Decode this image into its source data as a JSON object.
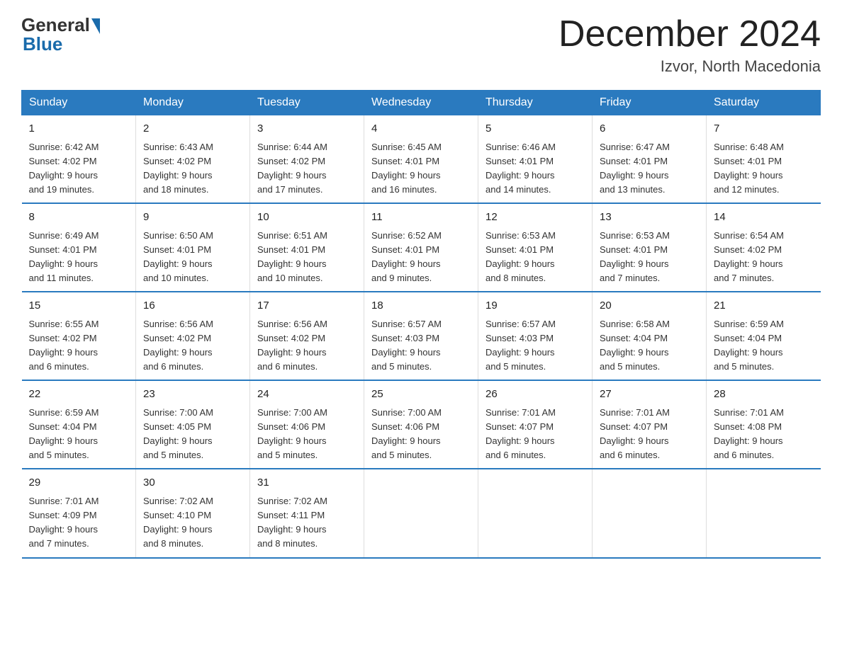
{
  "header": {
    "logo_general": "General",
    "logo_blue": "Blue",
    "month_title": "December 2024",
    "location": "Izvor, North Macedonia"
  },
  "weekdays": [
    "Sunday",
    "Monday",
    "Tuesday",
    "Wednesday",
    "Thursday",
    "Friday",
    "Saturday"
  ],
  "weeks": [
    [
      {
        "day": "1",
        "sunrise": "6:42 AM",
        "sunset": "4:02 PM",
        "daylight": "9 hours and 19 minutes."
      },
      {
        "day": "2",
        "sunrise": "6:43 AM",
        "sunset": "4:02 PM",
        "daylight": "9 hours and 18 minutes."
      },
      {
        "day": "3",
        "sunrise": "6:44 AM",
        "sunset": "4:02 PM",
        "daylight": "9 hours and 17 minutes."
      },
      {
        "day": "4",
        "sunrise": "6:45 AM",
        "sunset": "4:01 PM",
        "daylight": "9 hours and 16 minutes."
      },
      {
        "day": "5",
        "sunrise": "6:46 AM",
        "sunset": "4:01 PM",
        "daylight": "9 hours and 14 minutes."
      },
      {
        "day": "6",
        "sunrise": "6:47 AM",
        "sunset": "4:01 PM",
        "daylight": "9 hours and 13 minutes."
      },
      {
        "day": "7",
        "sunrise": "6:48 AM",
        "sunset": "4:01 PM",
        "daylight": "9 hours and 12 minutes."
      }
    ],
    [
      {
        "day": "8",
        "sunrise": "6:49 AM",
        "sunset": "4:01 PM",
        "daylight": "9 hours and 11 minutes."
      },
      {
        "day": "9",
        "sunrise": "6:50 AM",
        "sunset": "4:01 PM",
        "daylight": "9 hours and 10 minutes."
      },
      {
        "day": "10",
        "sunrise": "6:51 AM",
        "sunset": "4:01 PM",
        "daylight": "9 hours and 10 minutes."
      },
      {
        "day": "11",
        "sunrise": "6:52 AM",
        "sunset": "4:01 PM",
        "daylight": "9 hours and 9 minutes."
      },
      {
        "day": "12",
        "sunrise": "6:53 AM",
        "sunset": "4:01 PM",
        "daylight": "9 hours and 8 minutes."
      },
      {
        "day": "13",
        "sunrise": "6:53 AM",
        "sunset": "4:01 PM",
        "daylight": "9 hours and 7 minutes."
      },
      {
        "day": "14",
        "sunrise": "6:54 AM",
        "sunset": "4:02 PM",
        "daylight": "9 hours and 7 minutes."
      }
    ],
    [
      {
        "day": "15",
        "sunrise": "6:55 AM",
        "sunset": "4:02 PM",
        "daylight": "9 hours and 6 minutes."
      },
      {
        "day": "16",
        "sunrise": "6:56 AM",
        "sunset": "4:02 PM",
        "daylight": "9 hours and 6 minutes."
      },
      {
        "day": "17",
        "sunrise": "6:56 AM",
        "sunset": "4:02 PM",
        "daylight": "9 hours and 6 minutes."
      },
      {
        "day": "18",
        "sunrise": "6:57 AM",
        "sunset": "4:03 PM",
        "daylight": "9 hours and 5 minutes."
      },
      {
        "day": "19",
        "sunrise": "6:57 AM",
        "sunset": "4:03 PM",
        "daylight": "9 hours and 5 minutes."
      },
      {
        "day": "20",
        "sunrise": "6:58 AM",
        "sunset": "4:04 PM",
        "daylight": "9 hours and 5 minutes."
      },
      {
        "day": "21",
        "sunrise": "6:59 AM",
        "sunset": "4:04 PM",
        "daylight": "9 hours and 5 minutes."
      }
    ],
    [
      {
        "day": "22",
        "sunrise": "6:59 AM",
        "sunset": "4:04 PM",
        "daylight": "9 hours and 5 minutes."
      },
      {
        "day": "23",
        "sunrise": "7:00 AM",
        "sunset": "4:05 PM",
        "daylight": "9 hours and 5 minutes."
      },
      {
        "day": "24",
        "sunrise": "7:00 AM",
        "sunset": "4:06 PM",
        "daylight": "9 hours and 5 minutes."
      },
      {
        "day": "25",
        "sunrise": "7:00 AM",
        "sunset": "4:06 PM",
        "daylight": "9 hours and 5 minutes."
      },
      {
        "day": "26",
        "sunrise": "7:01 AM",
        "sunset": "4:07 PM",
        "daylight": "9 hours and 6 minutes."
      },
      {
        "day": "27",
        "sunrise": "7:01 AM",
        "sunset": "4:07 PM",
        "daylight": "9 hours and 6 minutes."
      },
      {
        "day": "28",
        "sunrise": "7:01 AM",
        "sunset": "4:08 PM",
        "daylight": "9 hours and 6 minutes."
      }
    ],
    [
      {
        "day": "29",
        "sunrise": "7:01 AM",
        "sunset": "4:09 PM",
        "daylight": "9 hours and 7 minutes."
      },
      {
        "day": "30",
        "sunrise": "7:02 AM",
        "sunset": "4:10 PM",
        "daylight": "9 hours and 8 minutes."
      },
      {
        "day": "31",
        "sunrise": "7:02 AM",
        "sunset": "4:11 PM",
        "daylight": "9 hours and 8 minutes."
      },
      null,
      null,
      null,
      null
    ]
  ],
  "labels": {
    "sunrise": "Sunrise:",
    "sunset": "Sunset:",
    "daylight": "Daylight:"
  }
}
